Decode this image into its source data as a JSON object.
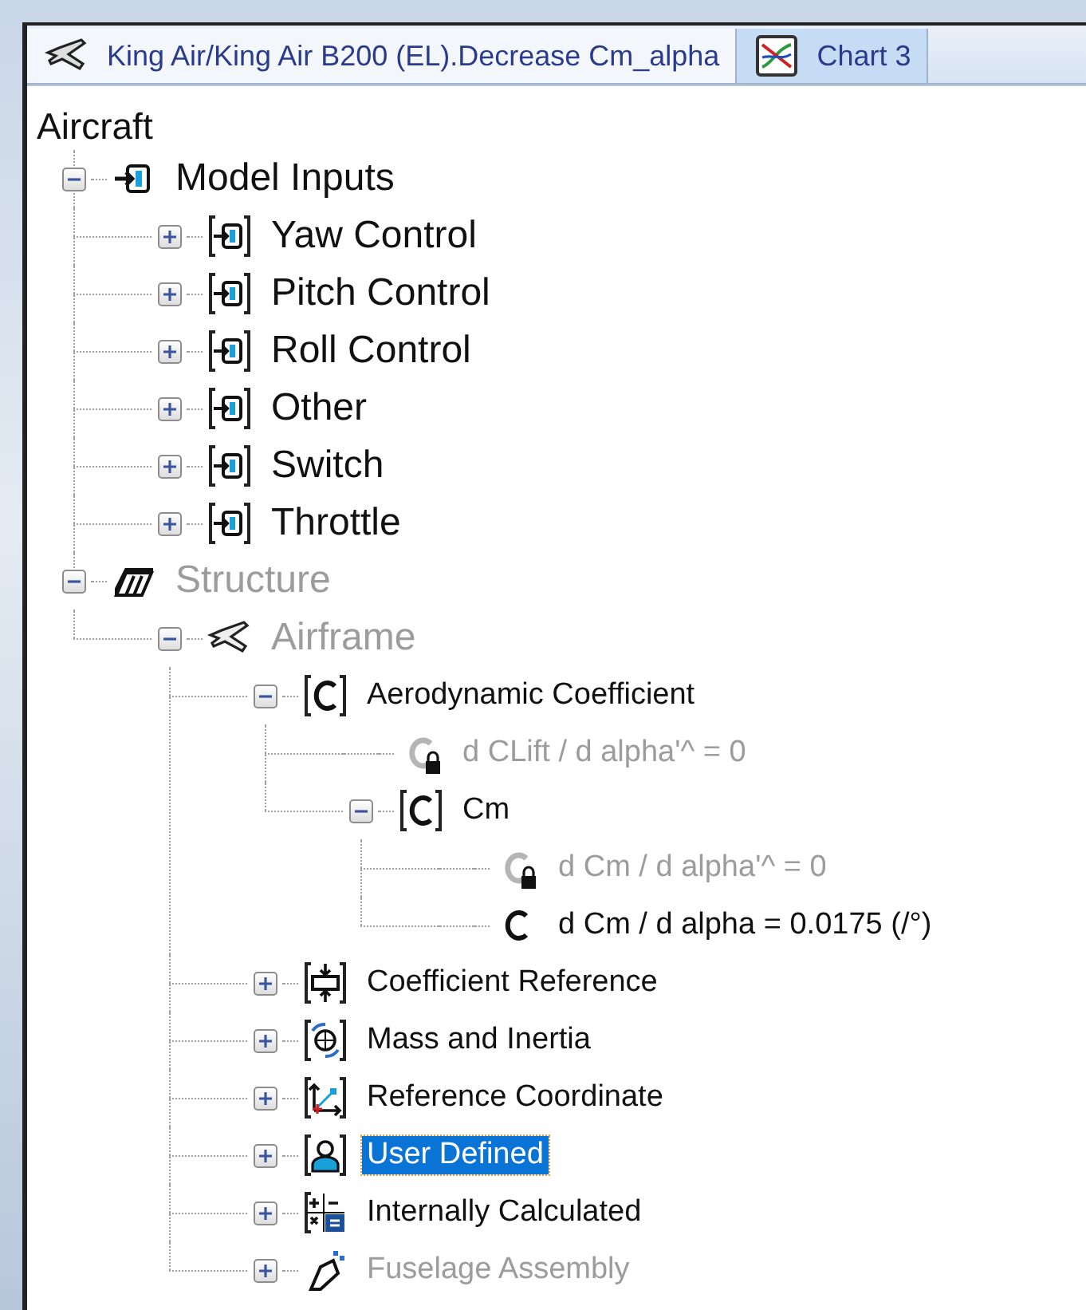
{
  "tabs": [
    {
      "label": "King Air/King Air B200 (EL).Decrease Cm_alpha",
      "kind": "aircraft",
      "selected": true
    },
    {
      "label": "Chart 3",
      "kind": "chart",
      "selected": false
    }
  ],
  "tree": {
    "label": "Aircraft",
    "selected": false,
    "children": [
      {
        "label": "Model Inputs",
        "kind": "input",
        "expanded": true,
        "disabled": false,
        "selected": false,
        "children": [
          {
            "label": "Yaw Control",
            "kind": "input-bracket",
            "expanded": false,
            "disabled": false,
            "selected": false
          },
          {
            "label": "Pitch Control",
            "kind": "input-bracket",
            "expanded": false,
            "disabled": false,
            "selected": false
          },
          {
            "label": "Roll Control",
            "kind": "input-bracket",
            "expanded": false,
            "disabled": false,
            "selected": false
          },
          {
            "label": "Other",
            "kind": "input-bracket",
            "expanded": false,
            "disabled": false,
            "selected": false
          },
          {
            "label": "Switch",
            "kind": "input-bracket",
            "expanded": false,
            "disabled": false,
            "selected": false
          },
          {
            "label": "Throttle",
            "kind": "input-bracket",
            "expanded": false,
            "disabled": false,
            "selected": false
          }
        ]
      },
      {
        "label": "Structure",
        "kind": "structure",
        "expanded": true,
        "disabled": true,
        "selected": false,
        "children": [
          {
            "label": "Airframe",
            "kind": "airframe",
            "expanded": true,
            "disabled": true,
            "selected": false,
            "children": [
              {
                "label": "Aerodynamic Coefficient",
                "kind": "coefficient",
                "expanded": true,
                "disabled": false,
                "selected": false,
                "children": [
                  {
                    "label": "d CLift / d alpha'^ = 0",
                    "kind": "locked",
                    "disabled": true,
                    "selected": false
                  },
                  {
                    "label": "Cm",
                    "kind": "coefficient",
                    "expanded": true,
                    "disabled": false,
                    "selected": false,
                    "children": [
                      {
                        "label": "d Cm / d alpha'^ = 0",
                        "kind": "locked",
                        "disabled": true,
                        "selected": false
                      },
                      {
                        "label": "d Cm / d alpha = 0.0175 (/°)",
                        "kind": "value",
                        "disabled": false,
                        "selected": false
                      }
                    ]
                  }
                ]
              },
              {
                "label": "Coefficient Reference",
                "kind": "reference",
                "expanded": false,
                "disabled": false,
                "selected": false
              },
              {
                "label": "Mass and Inertia",
                "kind": "mass",
                "expanded": false,
                "disabled": false,
                "selected": false
              },
              {
                "label": "Reference Coordinate",
                "kind": "coordinate",
                "expanded": false,
                "disabled": false,
                "selected": false
              },
              {
                "label": "User Defined",
                "kind": "user",
                "expanded": false,
                "disabled": false,
                "selected": true
              },
              {
                "label": "Internally Calculated",
                "kind": "calculated",
                "expanded": false,
                "disabled": false,
                "selected": false
              },
              {
                "label": "Fuselage Assembly",
                "kind": "fuselage",
                "expanded": false,
                "disabled": true,
                "selected": false
              }
            ]
          }
        ]
      }
    ]
  }
}
